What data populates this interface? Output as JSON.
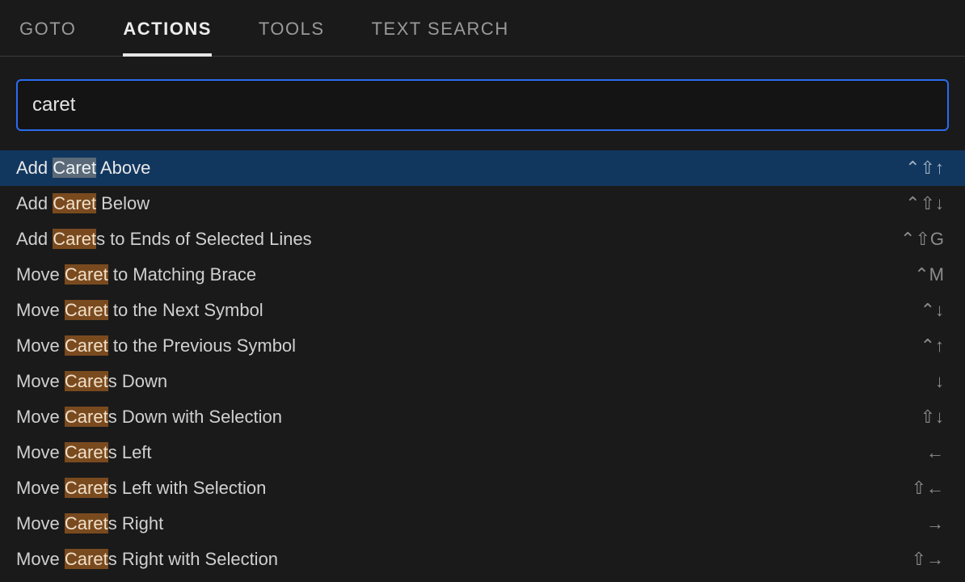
{
  "colors": {
    "bg": "#1a1a1a",
    "input_border_focus": "#2a6cf0",
    "selected_row_bg": "#12375f",
    "match_highlight_bg": "#7a4a1f",
    "match_highlight_bg_selected": "#5b6a78"
  },
  "tabs": {
    "items": [
      {
        "label": "GOTO",
        "active": false
      },
      {
        "label": "ACTIONS",
        "active": true
      },
      {
        "label": "TOOLS",
        "active": false
      },
      {
        "label": "TEXT SEARCH",
        "active": false
      }
    ]
  },
  "search": {
    "value": "caret",
    "placeholder": ""
  },
  "results": [
    {
      "label": "Add Caret Above",
      "match": "Caret",
      "shortcut": "⌃⇧↑",
      "selected": true
    },
    {
      "label": "Add Caret Below",
      "match": "Caret",
      "shortcut": "⌃⇧↓",
      "selected": false
    },
    {
      "label": "Add Carets to Ends of Selected Lines",
      "match": "Caret",
      "shortcut": "⌃⇧G",
      "selected": false
    },
    {
      "label": "Move Caret to Matching Brace",
      "match": "Caret",
      "shortcut": "⌃M",
      "selected": false
    },
    {
      "label": "Move Caret to the Next Symbol",
      "match": "Caret",
      "shortcut": "⌃↓",
      "selected": false
    },
    {
      "label": "Move Caret to the Previous Symbol",
      "match": "Caret",
      "shortcut": "⌃↑",
      "selected": false
    },
    {
      "label": "Move Carets Down",
      "match": "Caret",
      "shortcut": "↓",
      "selected": false
    },
    {
      "label": "Move Carets Down with Selection",
      "match": "Caret",
      "shortcut": "⇧↓",
      "selected": false
    },
    {
      "label": "Move Carets Left",
      "match": "Caret",
      "shortcut": "←",
      "selected": false
    },
    {
      "label": "Move Carets Left with Selection",
      "match": "Caret",
      "shortcut": "⇧←",
      "selected": false
    },
    {
      "label": "Move Carets Right",
      "match": "Caret",
      "shortcut": "→",
      "selected": false
    },
    {
      "label": "Move Carets Right with Selection",
      "match": "Caret",
      "shortcut": "⇧→",
      "selected": false
    }
  ]
}
